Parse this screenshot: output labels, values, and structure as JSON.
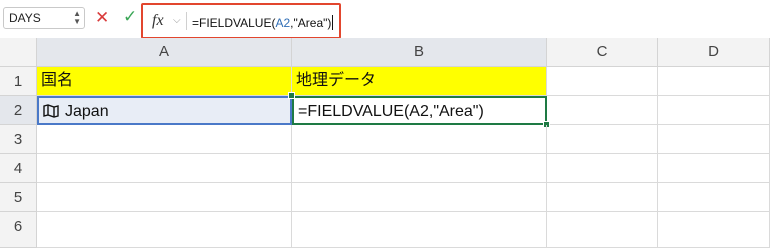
{
  "name_box": {
    "value": "DAYS"
  },
  "formula_bar": {
    "fx_label": "fx",
    "chevron": "⌵",
    "text_before": "=FIELDVALUE(",
    "text_ref": "A2",
    "text_after": ",\"Area\")",
    "ref_color": "#2f6db5",
    "highlight_color": "#e2462e"
  },
  "icons": {
    "cancel": "cross-icon",
    "confirm": "checkmark-icon",
    "map": "map-icon"
  },
  "columns": [
    "A",
    "B",
    "C",
    "D"
  ],
  "rows": [
    "1",
    "2",
    "3",
    "4",
    "5",
    "6"
  ],
  "cells": {
    "A1": "国名",
    "B1": "地理データ",
    "A2": "Japan",
    "B2": "=FIELDVALUE(A2,\"Area\")"
  },
  "colors": {
    "header_fill": "#ffff00",
    "active_border": "#1e7a44",
    "ref_border": "#4a79c8"
  }
}
